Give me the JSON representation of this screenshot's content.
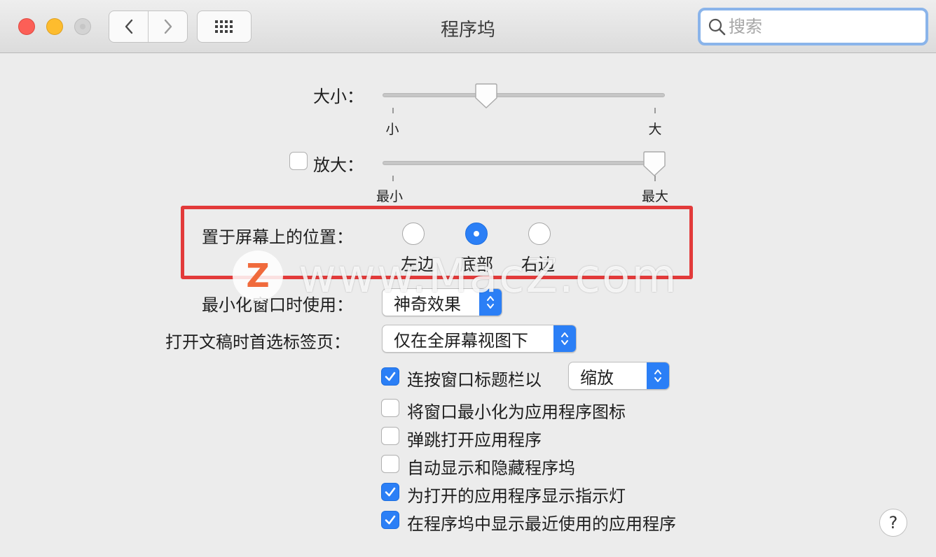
{
  "window": {
    "title": "程序坞"
  },
  "search": {
    "placeholder": "搜索"
  },
  "size": {
    "label": "大小：",
    "min_label": "小",
    "max_label": "大",
    "value_fraction": 0.37
  },
  "magnification": {
    "label": "放大：",
    "checked": false,
    "min_label": "最小",
    "max_label": "最大",
    "value_fraction": 0.97
  },
  "position": {
    "label": "置于屏幕上的位置：",
    "options": [
      "左边",
      "底部",
      "右边"
    ],
    "selected": "底部"
  },
  "minimize": {
    "label": "最小化窗口时使用：",
    "value": "神奇效果"
  },
  "open_docs": {
    "label": "打开文稿时首选标签页：",
    "value": "仅在全屏幕视图下"
  },
  "double_click": {
    "label": "连按窗口标题栏以",
    "checked": true,
    "value": "缩放"
  },
  "options": [
    {
      "label": "将窗口最小化为应用程序图标",
      "checked": false
    },
    {
      "label": "弹跳打开应用程序",
      "checked": false
    },
    {
      "label": "自动显示和隐藏程序坞",
      "checked": false
    },
    {
      "label": "为打开的应用程序显示指示灯",
      "checked": true
    },
    {
      "label": "在程序坞中显示最近使用的应用程序",
      "checked": true
    }
  ],
  "watermark": {
    "logo": "Z",
    "text": "www.MacZ.com"
  },
  "help": {
    "label": "?"
  },
  "colors": {
    "accent": "#2b7ff6",
    "highlight_box": "#e23a3a"
  }
}
